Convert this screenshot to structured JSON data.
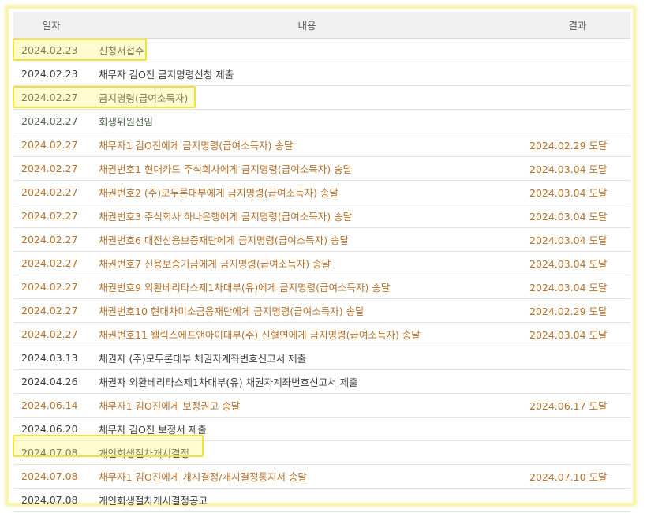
{
  "table": {
    "headers": {
      "date": "일자",
      "content": "내용",
      "result": "결과"
    },
    "rows": [
      {
        "date": "2024.02.23",
        "content": "신청서접수",
        "result": "",
        "tone": "dark"
      },
      {
        "date": "2024.02.23",
        "content": "채무자 김O진 금지명령신청 제출",
        "result": "",
        "tone": "dark"
      },
      {
        "date": "2024.02.27",
        "content": "금지명령(급여소득자)",
        "result": "",
        "tone": "dark"
      },
      {
        "date": "2024.02.27",
        "content": "회생위원선임",
        "result": "",
        "tone": "green"
      },
      {
        "date": "2024.02.27",
        "content": "채무자1 김O진에게 금지명령(급여소득자) 송달",
        "result": "2024.02.29 도달",
        "tone": "orange"
      },
      {
        "date": "2024.02.27",
        "content": "채권번호1 현대카드 주식회사에게 금지명령(급여소득자) 송달",
        "result": "2024.03.04 도달",
        "tone": "orange"
      },
      {
        "date": "2024.02.27",
        "content": "채권번호2 (주)모두론대부에게 금지명령(급여소득자) 송달",
        "result": "2024.03.04 도달",
        "tone": "orange"
      },
      {
        "date": "2024.02.27",
        "content": "채권번호3 주식회사 하나은행에게 금지명령(급여소득자) 송달",
        "result": "2024.03.04 도달",
        "tone": "orange"
      },
      {
        "date": "2024.02.27",
        "content": "채권번호6 대전신용보증재단에게 금지명령(급여소득자) 송달",
        "result": "2024.03.04 도달",
        "tone": "orange"
      },
      {
        "date": "2024.02.27",
        "content": "채권번호7 신용보증기금에게 금지명령(급여소득자) 송달",
        "result": "2024.03.04 도달",
        "tone": "orange"
      },
      {
        "date": "2024.02.27",
        "content": "채권번호9 외환베리타스제1차대부(유)에게 금지명령(급여소득자) 송달",
        "result": "2024.03.04 도달",
        "tone": "orange"
      },
      {
        "date": "2024.02.27",
        "content": "채권번호10 현대차미소금융재단에게 금지명령(급여소득자) 송달",
        "result": "2024.02.29 도달",
        "tone": "orange"
      },
      {
        "date": "2024.02.27",
        "content": "채권번호11 웰릭스에프앤아이대부(주) 신혈연에게 금지명령(급여소득자) 송달",
        "result": "2024.03.04 도달",
        "tone": "orange"
      },
      {
        "date": "2024.03.13",
        "content": "채권자 (주)모두론대부 채권자계좌번호신고서 제출",
        "result": "",
        "tone": "dark"
      },
      {
        "date": "2024.04.26",
        "content": "채권자 외환베리타스제1차대부(유) 채권자계좌번호신고서 제출",
        "result": "",
        "tone": "dark"
      },
      {
        "date": "2024.06.14",
        "content": "채무자1 김O진에게 보정권고 송달",
        "result": "2024.06.17 도달",
        "tone": "orange"
      },
      {
        "date": "2024.06.20",
        "content": "채무자 김O진 보정서 제출",
        "result": "",
        "tone": "dark"
      },
      {
        "date": "2024.07.08",
        "content": "개인회생절차개시결정",
        "result": "",
        "tone": "dark"
      },
      {
        "date": "2024.07.08",
        "content": "채무자1 김O진에게 개시결정/개시결정통지서 송달",
        "result": "2024.07.10 도달",
        "tone": "orange"
      },
      {
        "date": "2024.07.08",
        "content": "개인회생절차개시결정공고",
        "result": "",
        "tone": "dark"
      }
    ]
  },
  "colors": {
    "orange": "#b8722c",
    "dark": "#3c3c3c",
    "green": "#4f6b4c",
    "highlight": "#f2e33a"
  }
}
